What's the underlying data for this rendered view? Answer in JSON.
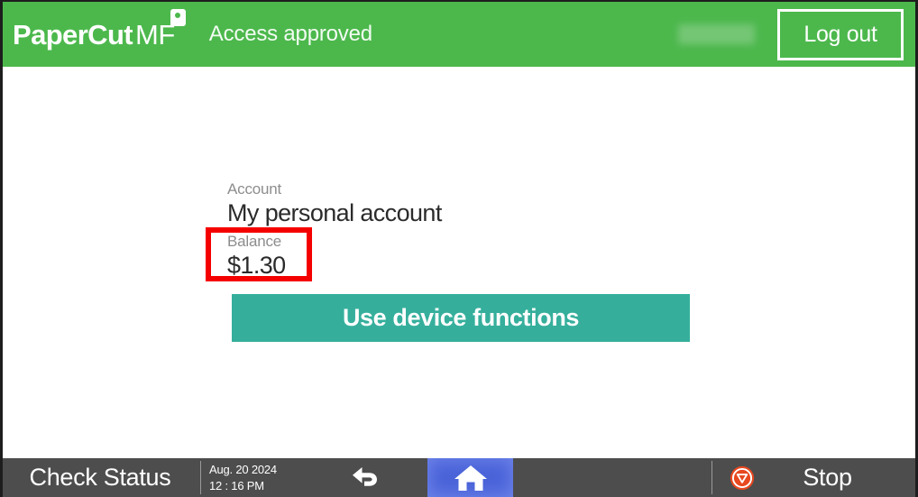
{
  "header": {
    "brand_primary": "PaperCut",
    "brand_secondary": "MF",
    "brand_tag_icon": "papercut-tag-icon",
    "status_text": "Access approved",
    "username_redacted": "",
    "logout_label": "Log out",
    "background_color": "#4cb84c"
  },
  "main": {
    "account_label": "Account",
    "account_value": "My personal account",
    "balance_label": "Balance",
    "balance_value": "$1.30",
    "balance_highlight_color": "#f50000",
    "primary_action_label": "Use device functions",
    "primary_action_color": "#35af9c"
  },
  "bottom_bar": {
    "check_status_label": "Check Status",
    "date": "Aug. 20 2024",
    "time": "12 : 16 PM",
    "back_icon": "back-arrow-icon",
    "home_icon": "home-icon",
    "home_active_color": "#4a63d8",
    "stop_icon": "stop-icon",
    "stop_label": "Stop",
    "background_color": "#4d4d4d"
  }
}
